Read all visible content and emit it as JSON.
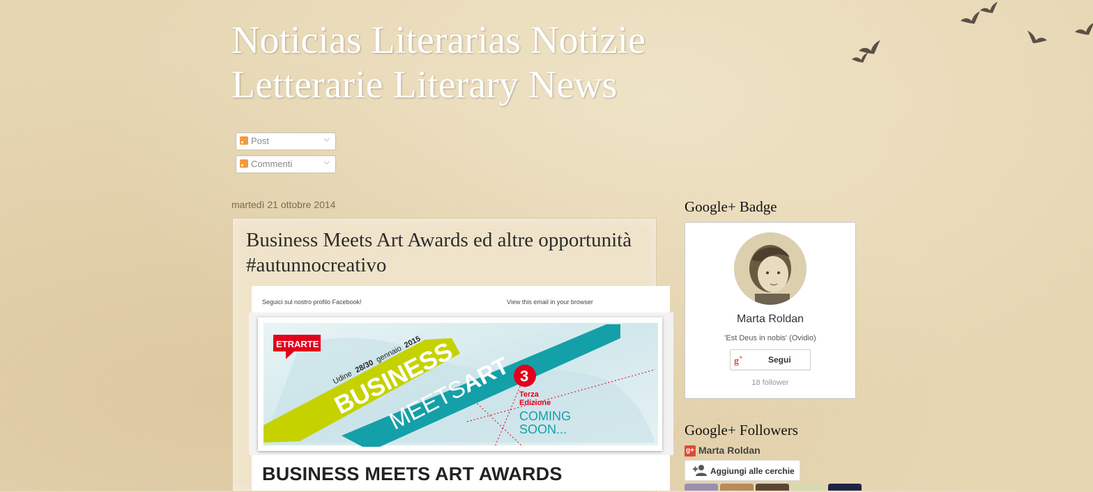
{
  "blog": {
    "title": "Noticias Literarias Notizie Letterarie Literary News"
  },
  "subscribe": {
    "posts_label": "Post",
    "comments_label": "Commenti"
  },
  "post": {
    "date": "martedì 21 ottobre 2014",
    "title": "Business Meets Art Awards ed altre opportunità #autunnocreativo",
    "email_top_left": "Seguici sul nostro profilo Facebook!",
    "email_top_right": "View this email in your browser",
    "banner": {
      "logo": "ETRARTE",
      "date_line_1": "Udine",
      "date_line_2": "28/30",
      "date_line_3": "gennaio",
      "date_line_4": "2015",
      "word_business": "BUSINESS",
      "word_meets": "MEETS",
      "word_art": "ART",
      "edition_number": "3",
      "edition_line_1": "Terza",
      "edition_line_2": "Edizione",
      "coming_1": "COMING",
      "coming_2": "SOON...",
      "colors": {
        "red": "#e3001b",
        "green": "#c5d200",
        "teal": "#14a0a8"
      }
    },
    "heading": "BUSINESS MEETS ART AWARDS"
  },
  "sidebar": {
    "badge_title": "Google+ Badge",
    "badge": {
      "name": "Marta Roldan",
      "quote": "'Est Deus in nobis' (Ovidio)",
      "follow_label": "Segui",
      "follower_count": "18 follower"
    },
    "followers_title": "Google+ Followers",
    "followers_owner": "Marta Roldan",
    "add_circles_label": "Aggiungi alle cerchie"
  },
  "icons": [
    "rss-feed-icon",
    "chevron-down-icon",
    "google-plus-icon",
    "add-person-icon",
    "bird-icon"
  ]
}
